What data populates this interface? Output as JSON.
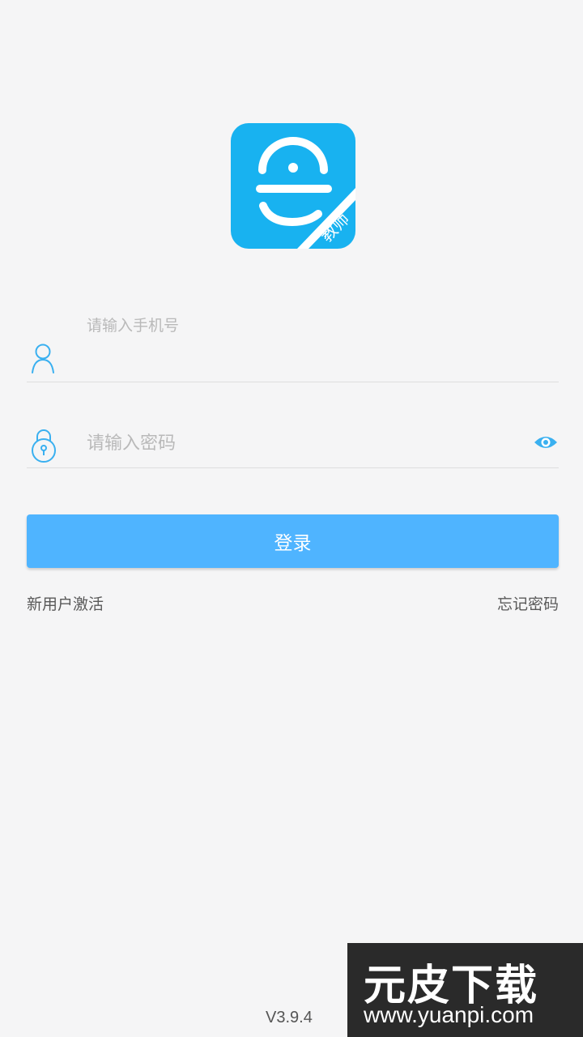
{
  "logo": {
    "badge_text": "教师"
  },
  "phone_field": {
    "placeholder": "请输入手机号"
  },
  "password_field": {
    "placeholder": "请输入密码"
  },
  "login_button": {
    "label": "登录"
  },
  "links": {
    "activate": "新用户激活",
    "forgot_password": "忘记密码"
  },
  "version": "V3.9.4",
  "watermark": {
    "title": "元皮下载",
    "url": "www.yuanpi.com"
  },
  "colors": {
    "accent": "#4fb4ff",
    "logo_blue": "#18b2f0",
    "icon_blue": "#3ab0f0"
  },
  "icons": [
    "user-icon",
    "lock-icon",
    "eye-icon"
  ]
}
